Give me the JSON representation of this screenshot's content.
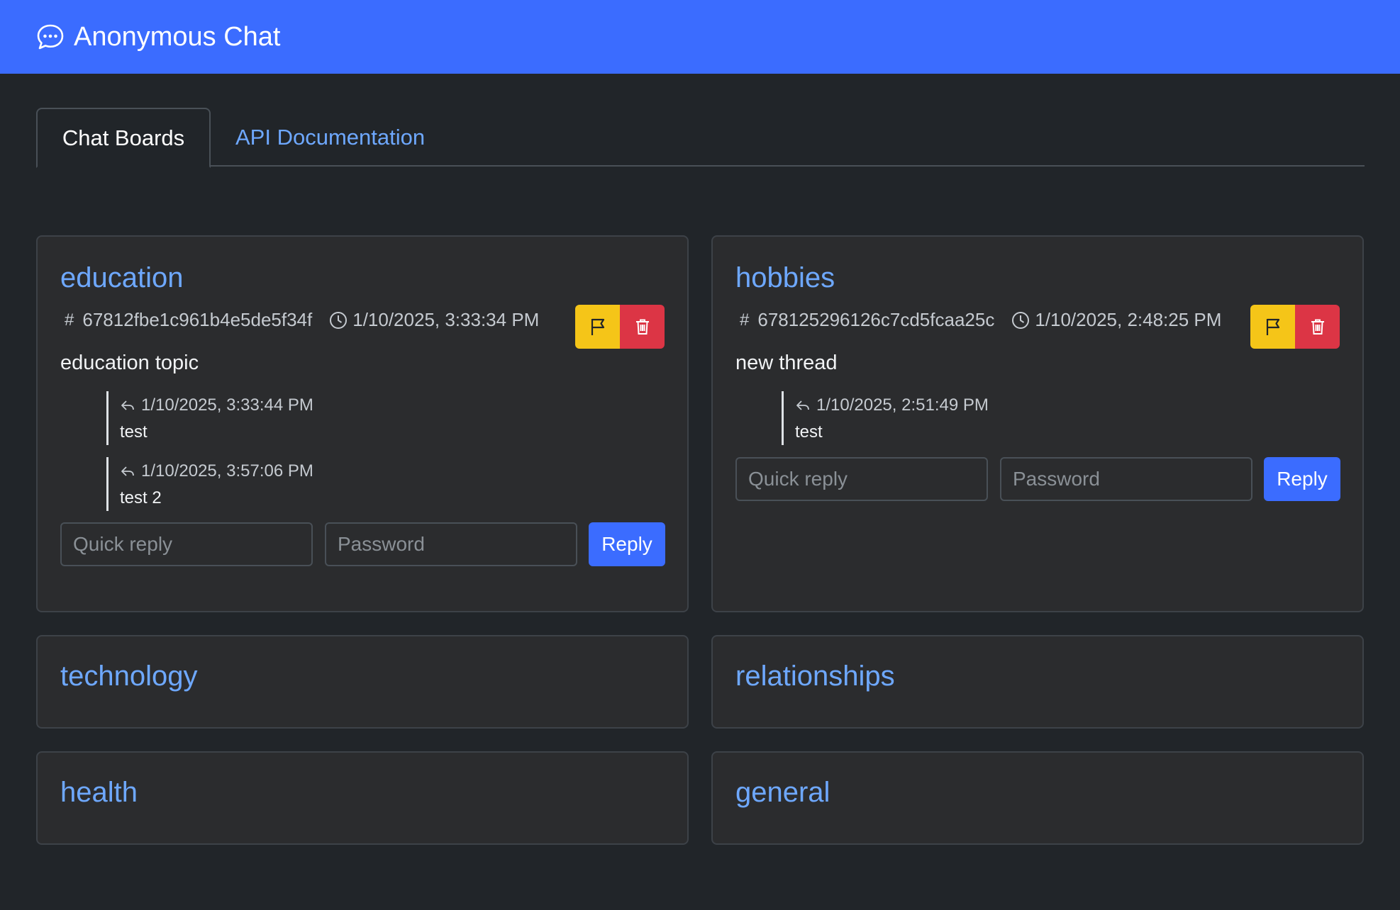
{
  "app": {
    "title": "Anonymous Chat",
    "icon": "chat-dots-icon",
    "brand_color": "#3b6cff"
  },
  "tabs": [
    {
      "label": "Chat Boards",
      "active": true
    },
    {
      "label": "API Documentation",
      "active": false
    }
  ],
  "boards": {
    "education": {
      "name": "education",
      "thread": {
        "hash_symbol": "#",
        "id": "67812fbe1c961b4e5de5f34f",
        "date": "1/10/2025, 3:33:34 PM",
        "text": "education topic",
        "replies": [
          {
            "date": "1/10/2025, 3:33:44 PM",
            "text": "test"
          },
          {
            "date": "1/10/2025, 3:57:06 PM",
            "text": "test 2"
          }
        ]
      },
      "quick_reply_placeholder": "Quick reply",
      "password_placeholder": "Password",
      "reply_label": "Reply"
    },
    "hobbies": {
      "name": "hobbies",
      "thread": {
        "hash_symbol": "#",
        "id": "678125296126c7cd5fcaa25c",
        "date": "1/10/2025, 2:48:25 PM",
        "text": "new thread",
        "replies": [
          {
            "date": "1/10/2025, 2:51:49 PM",
            "text": "test"
          }
        ]
      },
      "quick_reply_placeholder": "Quick reply",
      "password_placeholder": "Password",
      "reply_label": "Reply"
    },
    "technology": {
      "name": "technology"
    },
    "relationships": {
      "name": "relationships"
    },
    "health": {
      "name": "health"
    },
    "general": {
      "name": "general"
    }
  },
  "colors": {
    "report": "#f5c518",
    "delete": "#dc3545",
    "link": "#6ea8fe"
  }
}
